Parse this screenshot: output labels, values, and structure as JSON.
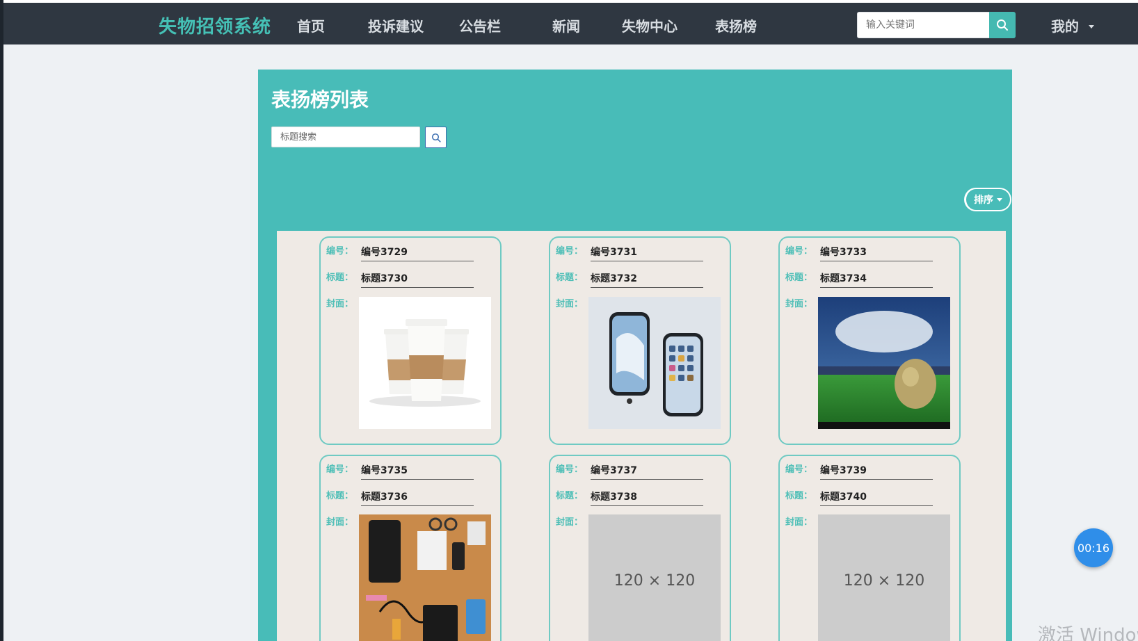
{
  "brand": "失物招领系统",
  "nav": {
    "items": [
      "首页",
      "投诉建议",
      "公告栏",
      "新闻",
      "失物中心",
      "表扬榜"
    ],
    "search_placeholder": "输入关键词",
    "mine_label": "我的"
  },
  "panel": {
    "title": "表扬榜列表",
    "search_placeholder": "标题搜索",
    "sort_label": "排序"
  },
  "labels": {
    "number": "编号：",
    "title": "标题：",
    "cover": "封面："
  },
  "cards": [
    {
      "number": "编号3729",
      "title": "标题3730",
      "cover": "coffee-cups"
    },
    {
      "number": "编号3731",
      "title": "标题3732",
      "cover": "phones"
    },
    {
      "number": "编号3733",
      "title": "标题3734",
      "cover": "stadium-ball"
    },
    {
      "number": "编号3735",
      "title": "标题3736",
      "cover": "desk-flatlay"
    },
    {
      "number": "编号3737",
      "title": "标题3738",
      "cover": "placeholder",
      "placeholder_text": "120 × 120"
    },
    {
      "number": "编号3739",
      "title": "标题3740",
      "cover": "placeholder",
      "placeholder_text": "120 × 120"
    }
  ],
  "timer": "00:16",
  "watermark": "激活 Windows",
  "colors": {
    "navbar": "#2f3741",
    "brand": "#45c1b6",
    "panel": "#48bcb8",
    "card_border": "#6fcac3",
    "grid_bg": "#efeae5",
    "timer": "#2f8ee9"
  }
}
